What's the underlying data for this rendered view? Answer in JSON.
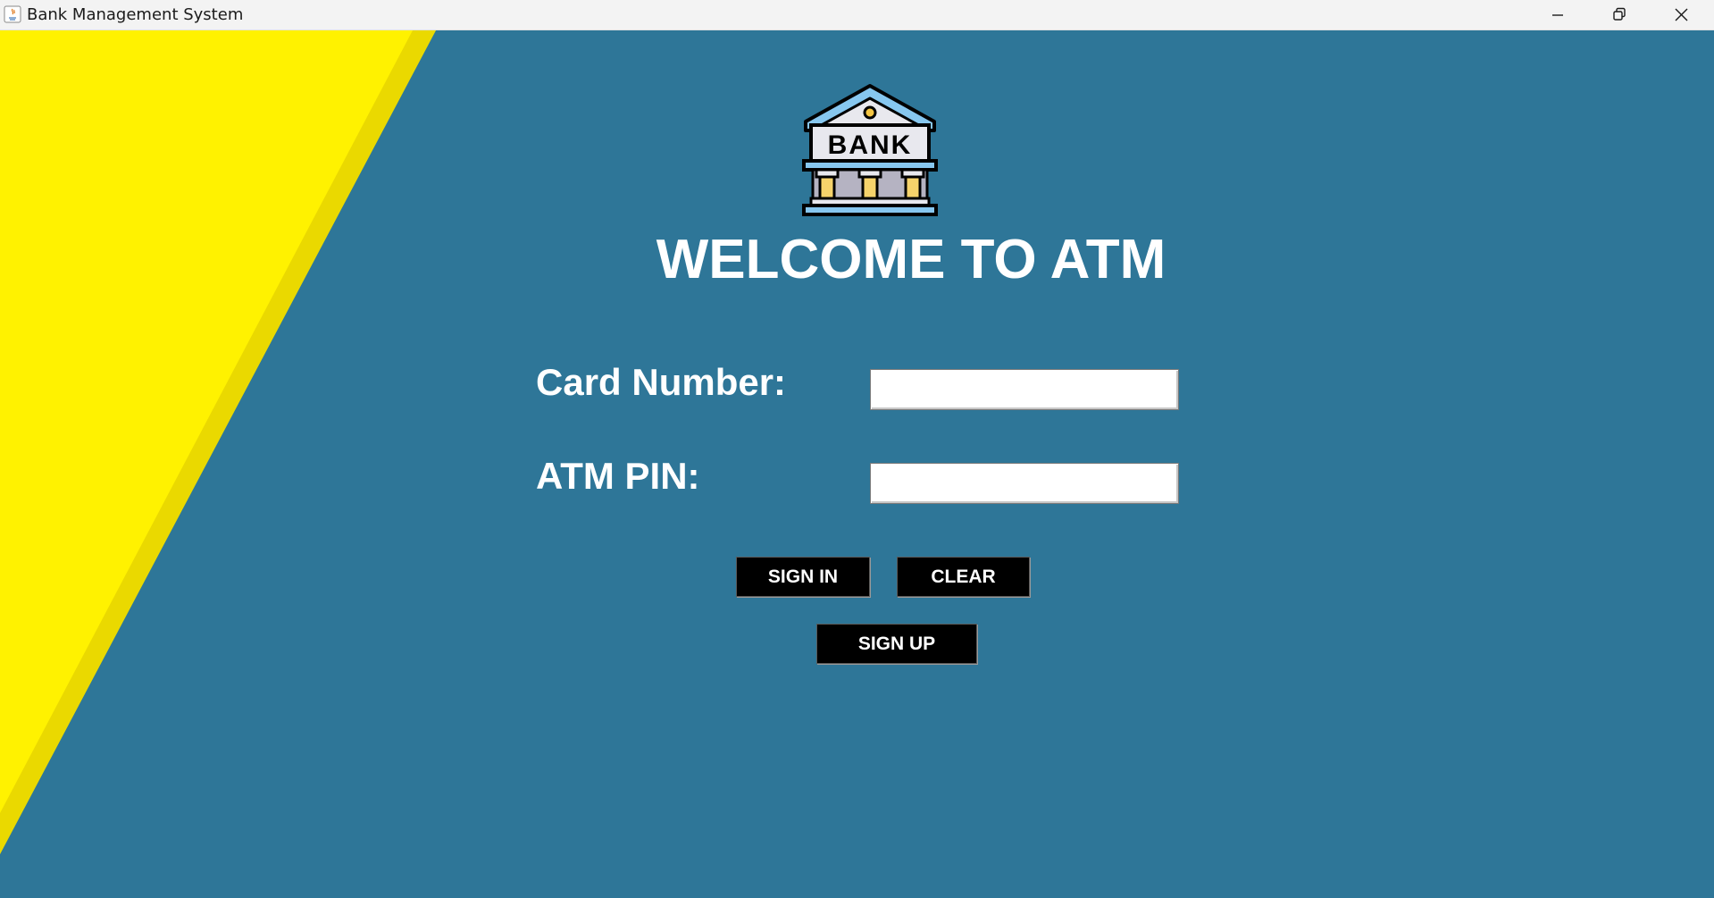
{
  "window": {
    "title": "Bank Management System",
    "controls": [
      "minimize-icon",
      "restore-icon",
      "close-icon"
    ]
  },
  "logo": {
    "text": "BANK",
    "icon": "bank-building-icon"
  },
  "heading": "WELCOME TO ATM",
  "form": {
    "card_label": "Card Number:",
    "card_value": "",
    "pin_label": "ATM PIN:",
    "pin_value": ""
  },
  "buttons": {
    "sign_in": "SIGN IN",
    "clear": "CLEAR",
    "sign_up": "SIGN UP"
  },
  "colors": {
    "background": "#2e7698",
    "stripe": "#fff200",
    "button": "#000000",
    "text": "#ffffff"
  }
}
